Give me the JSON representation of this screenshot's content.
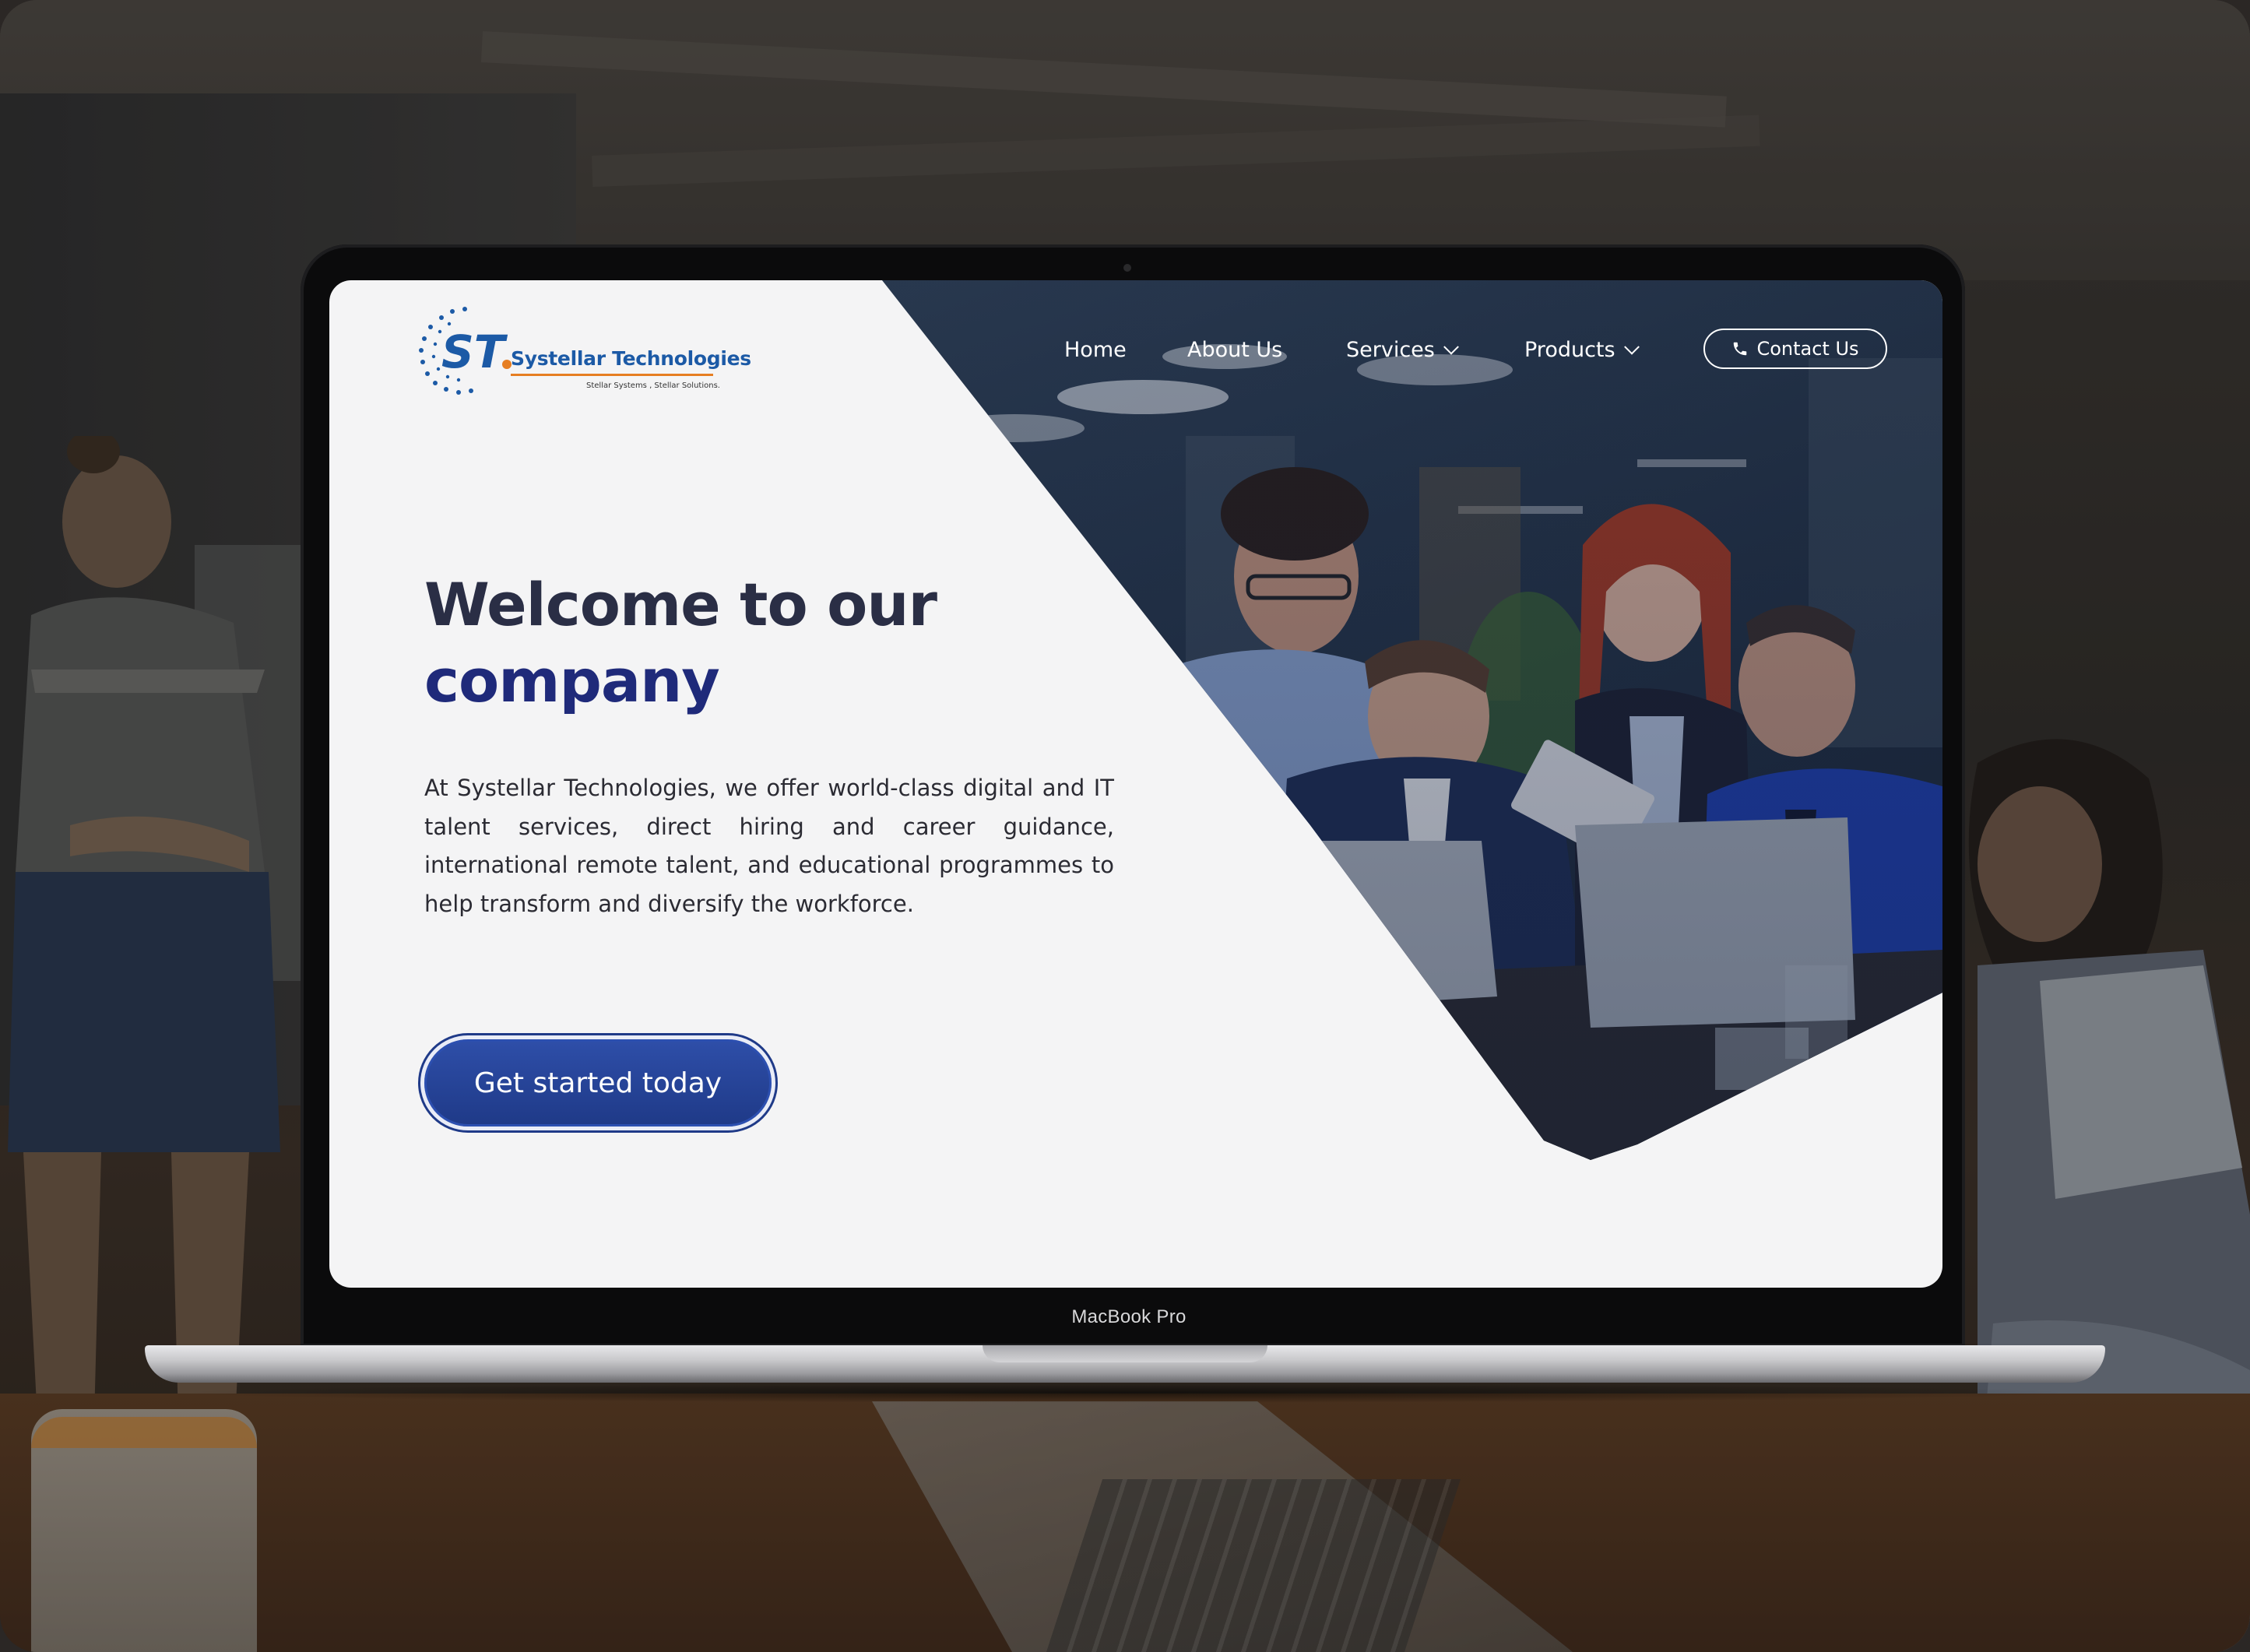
{
  "device": {
    "label": "MacBook Pro"
  },
  "site": {
    "logo": {
      "initials": "ST",
      "name": "Systellar Technologies",
      "tagline": "Stellar Systems , Stellar Solutions."
    },
    "nav": {
      "items": [
        {
          "label": "Home",
          "has_dropdown": false
        },
        {
          "label": "About Us",
          "has_dropdown": false
        },
        {
          "label": "Services",
          "has_dropdown": true
        },
        {
          "label": "Products",
          "has_dropdown": true
        }
      ],
      "contact_label": "Contact Us"
    },
    "hero": {
      "title_line1": "Welcome to our",
      "title_line2": "company",
      "body": "At Systellar Technologies, we offer world-class digital and IT talent services, direct hiring and career guidance, international remote talent, and educational programmes to help transform and diversify the workforce.",
      "cta_label": "Get started today"
    }
  },
  "colors": {
    "brand_blue": "#1c5aa6",
    "title_dark": "#2a2e45",
    "title_navy": "#1f2a7a",
    "cta_blue": "#1f3a88",
    "screen_bg": "#f4f4f5",
    "accent_orange": "#e67e22"
  },
  "icons": [
    "phone-icon",
    "chevron-down-icon"
  ]
}
